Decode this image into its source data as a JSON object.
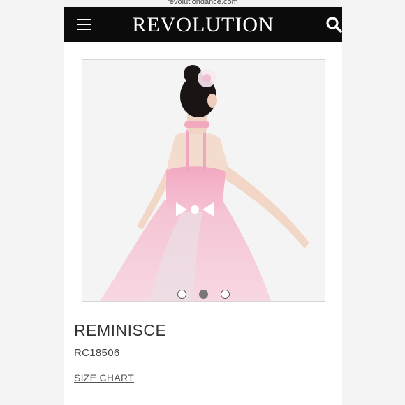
{
  "browser": {
    "url": "revolutiondance.com"
  },
  "header": {
    "brand": "REVOLUTION",
    "menu_icon": "hamburger-menu-icon",
    "search_icon": "search-icon",
    "background_color": "#0b0b0b"
  },
  "gallery": {
    "image_description_icon": "product-photo",
    "slide_count": 3,
    "active_slide": 2
  },
  "product": {
    "name": "REMINISCE",
    "sku": "RC18506",
    "size_chart_label": "SIZE CHART"
  }
}
